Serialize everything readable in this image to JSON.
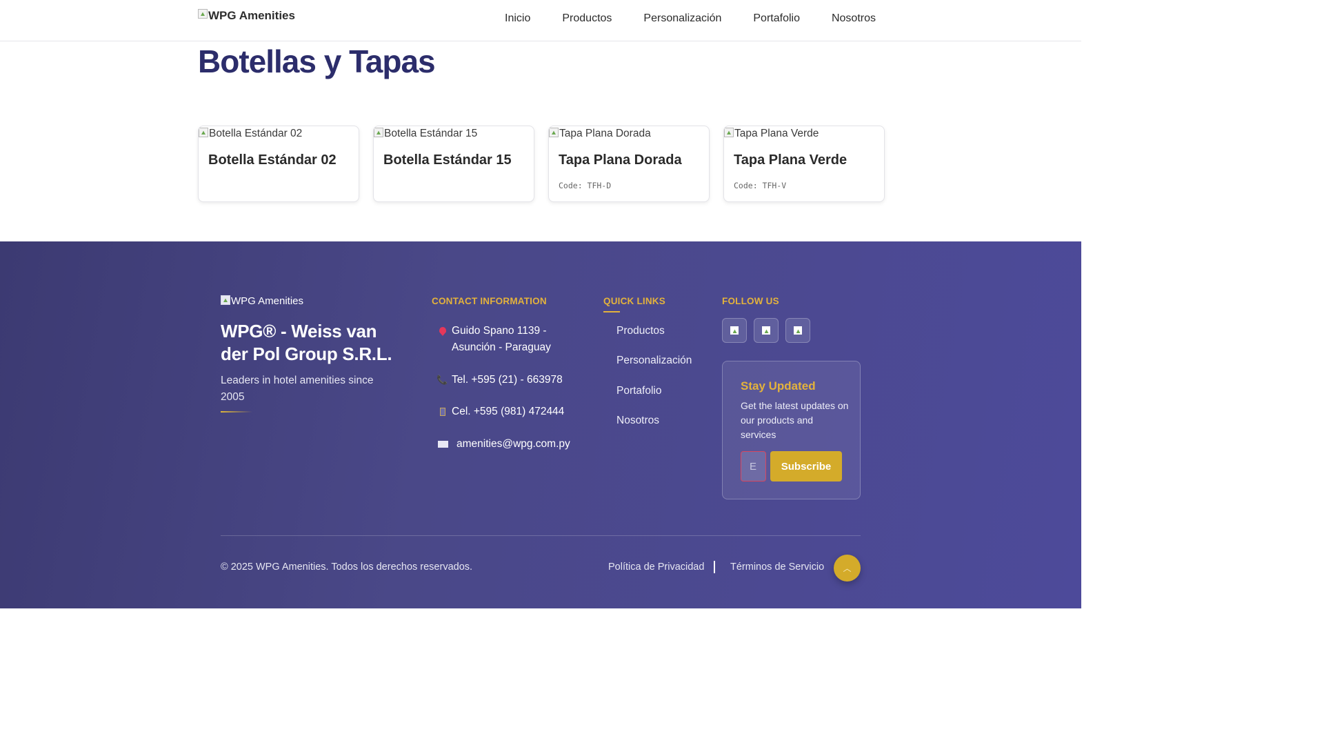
{
  "header": {
    "logo_alt": "WPG Amenities",
    "nav": [
      "Inicio",
      "Productos",
      "Personalización",
      "Portafolio",
      "Nosotros"
    ]
  },
  "main": {
    "title": "Botellas y Tapas",
    "products": [
      {
        "img_alt": "Botella Estándar 02",
        "name": "Botella Estándar 02",
        "code": ""
      },
      {
        "img_alt": "Botella Estándar 15",
        "name": "Botella Estándar 15",
        "code": ""
      },
      {
        "img_alt": "Tapa Plana Dorada",
        "name": "Tapa Plana Dorada",
        "code": "Code: TFH-D"
      },
      {
        "img_alt": "Tapa Plana Verde",
        "name": "Tapa Plana Verde",
        "code": "Code: TFH-V"
      }
    ]
  },
  "footer": {
    "logo_alt": "WPG Amenities",
    "company": "WPG® - Weiss van der Pol Group S.R.L.",
    "tagline": "Leaders in hotel amenities since 2005",
    "contact": {
      "heading": "CONTACT INFORMATION",
      "address": "Guido Spano 1139 - Asunción - Paraguay",
      "tel": "Tel. +595 (21) - 663978",
      "cel": "Cel. +595 (981) 472444",
      "email": "amenities@wpg.com.py"
    },
    "quick_links": {
      "heading": "QUICK LINKS",
      "items": [
        "Productos",
        "Personalización",
        "Portafolio",
        "Nosotros"
      ]
    },
    "follow": {
      "heading": "FOLLOW US",
      "icons": [
        "social-icon-1",
        "social-icon-2",
        "social-icon-3"
      ]
    },
    "newsletter": {
      "title": "Stay Updated",
      "text": "Get the latest updates on our products and services",
      "placeholder": "E",
      "button": "Subscribe"
    },
    "copyright": "© 2025 WPG Amenities. Todos los derechos reservados.",
    "privacy": "Política de Privacidad",
    "terms": "Términos de Servicio",
    "back_to_top_icon": "chevron-up-icon"
  },
  "colors": {
    "title": "#2c2d6b",
    "accent": "#e3b23c",
    "footer_bg": "#4a4888",
    "button": "#d4ab2a"
  }
}
